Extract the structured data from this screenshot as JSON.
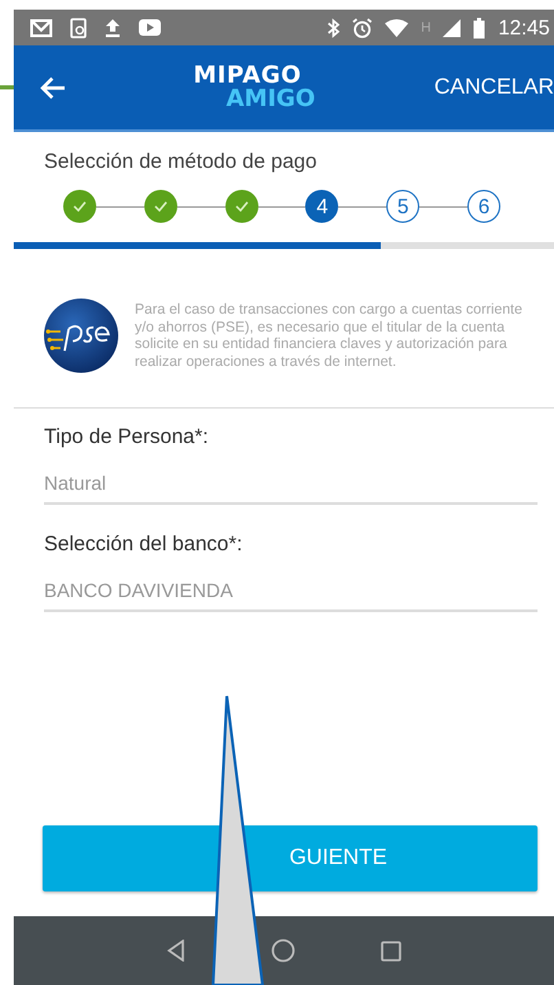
{
  "status_bar": {
    "network_type": "H",
    "time": "12:45"
  },
  "header": {
    "logo_top": "MIPAGO",
    "logo_bottom": "AMIGO",
    "cancel": "CANCELAR"
  },
  "stepper": {
    "title": "Selección de método de pago",
    "level": 0.68,
    "steps": [
      {
        "kind": "done"
      },
      {
        "kind": "done"
      },
      {
        "kind": "done"
      },
      {
        "label": "4",
        "kind": "current"
      },
      {
        "label": "5",
        "kind": "pending"
      },
      {
        "label": "6",
        "kind": "pending"
      }
    ]
  },
  "notice": {
    "text": "Para el caso de transacciones con cargo a cuentas corriente y/o ahorros (PSE), es necesario que el titular de la cuenta solicite en su entidad financiera claves y autorización para realizar operaciones a través de internet."
  },
  "fields": [
    {
      "label": "Tipo de Persona*:",
      "value": "Natural"
    },
    {
      "label": "Selección del banco*:",
      "value": "BANCO DAVIVIENDA"
    }
  ],
  "button": {
    "label": "GUIENTE"
  }
}
